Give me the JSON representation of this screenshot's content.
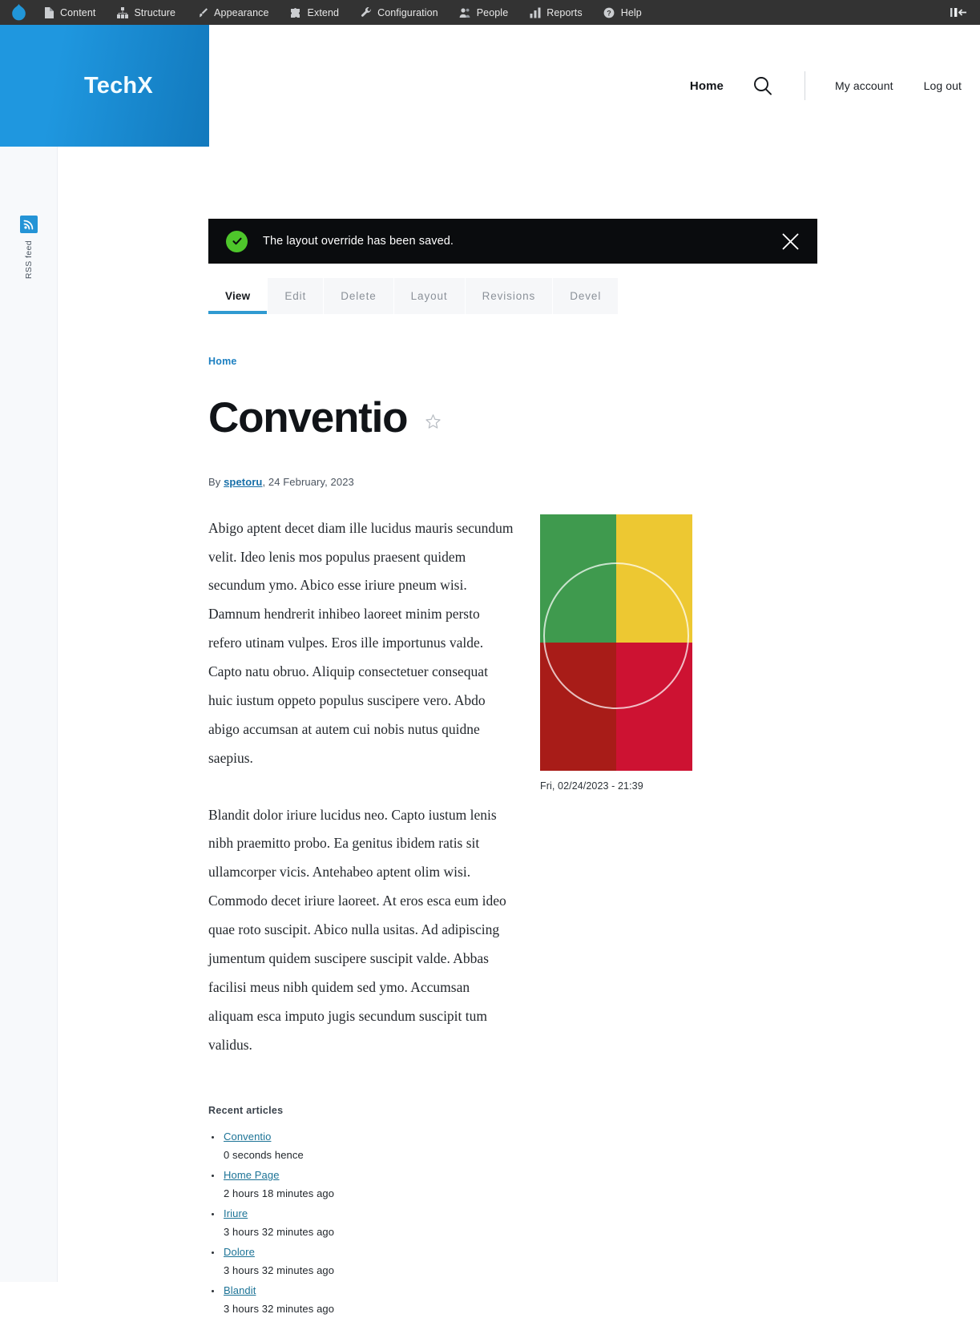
{
  "toolbar": {
    "logo_name": "drupal-logo",
    "items": [
      {
        "label": "Content",
        "icon": "file-icon"
      },
      {
        "label": "Structure",
        "icon": "sitemap-icon"
      },
      {
        "label": "Appearance",
        "icon": "paintbrush-icon"
      },
      {
        "label": "Extend",
        "icon": "puzzle-icon"
      },
      {
        "label": "Configuration",
        "icon": "wrench-icon"
      },
      {
        "label": "People",
        "icon": "people-icon"
      },
      {
        "label": "Reports",
        "icon": "bar-chart-icon"
      },
      {
        "label": "Help",
        "icon": "question-circle-icon"
      }
    ],
    "collapse_icon": "toolbar-collapse-icon",
    "background": "#333333"
  },
  "sidebar": {
    "rss": {
      "label": "RSS feed",
      "icon": "rss-feed-icon",
      "color": "#2494d6"
    }
  },
  "header": {
    "brand": "TechX",
    "brand_gradient_from": "#1f97df",
    "brand_gradient_to": "#1279bd",
    "nav": {
      "home": "Home",
      "search_icon": "search-icon",
      "my_account": "My account",
      "log_out": "Log out"
    }
  },
  "status": {
    "text": "The layout override has been saved.",
    "icon": "success-check-icon",
    "close_icon": "close-icon",
    "background": "#0a0c0e",
    "accent": "#4ec62b"
  },
  "tabs": [
    {
      "label": "View",
      "active": true
    },
    {
      "label": "Edit",
      "active": false
    },
    {
      "label": "Delete",
      "active": false
    },
    {
      "label": "Layout",
      "active": false
    },
    {
      "label": "Revisions",
      "active": false
    },
    {
      "label": "Devel",
      "active": false
    }
  ],
  "breadcrumb": "Home",
  "node": {
    "title": "Conventio",
    "bookmark_icon": "star-outline-icon",
    "byline_prefix": "By ",
    "author": "spetoru",
    "byline_suffix": ", 24 February, 2023",
    "body": [
      "Abigo aptent decet diam ille lucidus mauris secundum velit. Ideo lenis mos populus praesent quidem secundum ymo. Abico esse iriure pneum wisi. Damnum hendrerit inhibeo laoreet minim persto refero utinam vulpes. Eros ille importunus valde. Capto natu obruo. Aliquip consectetuer consequat huic iustum oppeto populus suscipere vero. Abdo abigo accumsan at autem cui nobis nutus quidne saepius.",
      "Blandit dolor iriure lucidus neo. Capto iustum lenis nibh praemitto probo. Ea genitus ibidem ratis sit ullamcorper vicis. Antehabeo aptent olim wisi. Commodo decet iriure laoreet. At eros esca eum ideo quae roto suscipit. Abico nulla usitas. Ad adipiscing jumentum quidem suscipere suscipit valde. Abbas facilisi meus nibh quidem sed ymo. Accumsan aliquam esca imputo jugis secundum suscipit tum validus."
    ],
    "figure": {
      "caption": "Fri, 02/24/2023 - 21:39",
      "quadrants": [
        {
          "name": "top-left",
          "color": "#3f9a4e"
        },
        {
          "name": "top-right",
          "color": "#edc832"
        },
        {
          "name": "bottom-left",
          "color": "#a81c18"
        },
        {
          "name": "bottom-right",
          "color": "#cd1232"
        }
      ]
    }
  },
  "recent": {
    "title": "Recent articles",
    "items": [
      {
        "label": "Conventio",
        "time": "0 seconds hence"
      },
      {
        "label": "Home Page",
        "time": "2 hours 18 minutes ago"
      },
      {
        "label": "Iriure",
        "time": "3 hours 32 minutes ago"
      },
      {
        "label": "Dolore",
        "time": "3 hours 32 minutes ago"
      },
      {
        "label": "Blandit",
        "time": "3 hours 32 minutes ago"
      }
    ]
  }
}
